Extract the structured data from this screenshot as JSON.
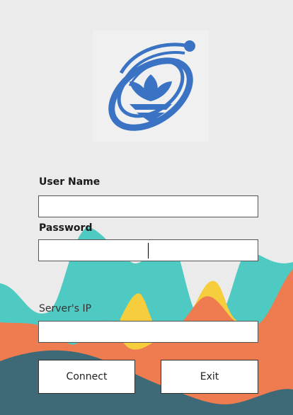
{
  "logo": {
    "icon": "lotus-orbit-logo-icon",
    "color": "#3a73c4"
  },
  "form": {
    "username": {
      "label": "User Name",
      "value": "",
      "placeholder": ""
    },
    "password": {
      "label": "Password",
      "value": "",
      "placeholder": ""
    },
    "server_ip": {
      "label": "Server's IP",
      "value": "",
      "placeholder": ""
    }
  },
  "buttons": {
    "connect_label": "Connect",
    "exit_label": "Exit"
  },
  "colors": {
    "background": "#ebebeb",
    "teal": "#4fcac3",
    "yellow": "#f5cd3d",
    "orange": "#ee7c50",
    "dark_teal": "#3d6a76"
  }
}
